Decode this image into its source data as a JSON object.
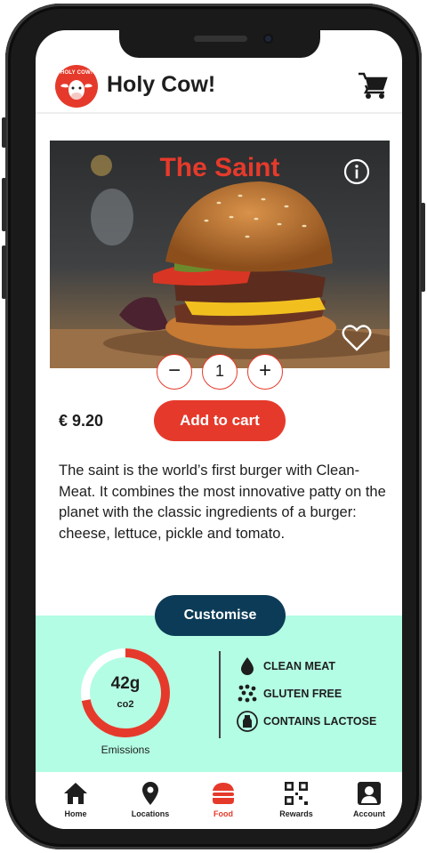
{
  "header": {
    "logo_text": "HOLY COW!",
    "app_title": "Holy Cow!"
  },
  "product": {
    "name": "The Saint",
    "quantity": "1",
    "price": "€ 9.20",
    "add_to_cart_label": "Add to cart",
    "description": "The saint is the world’s first burger with Clean-Meat. It combines the most innovative patty on the planet with the classic ingredients of a burger: cheese, lettuce, pickle and tomato."
  },
  "customise_label": "Customise",
  "emissions": {
    "value": "42g",
    "unit": "co2",
    "label": "Emissions",
    "fill_fraction": 0.72
  },
  "attributes": [
    {
      "icon": "droplet-icon",
      "label": "CLEAN MEAT"
    },
    {
      "icon": "dots-icon",
      "label": "GLUTEN FREE"
    },
    {
      "icon": "milk-bottle-icon",
      "label": "CONTAINS LACTOSE"
    }
  ],
  "nav": {
    "active": "Food",
    "items": [
      {
        "icon": "home-icon",
        "label": "Home"
      },
      {
        "icon": "location-pin-icon",
        "label": "Locations"
      },
      {
        "icon": "burger-icon",
        "label": "Food"
      },
      {
        "icon": "qr-code-icon",
        "label": "Rewards"
      },
      {
        "icon": "account-icon",
        "label": "Account"
      }
    ]
  },
  "colors": {
    "brand_red": "#e53a2b",
    "navy": "#0c3b57",
    "mint": "#b3fde4",
    "text": "#1e1e1e"
  }
}
